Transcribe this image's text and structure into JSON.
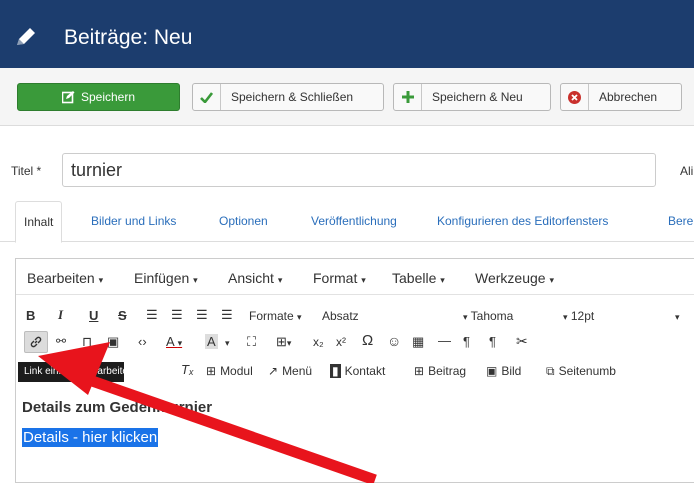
{
  "header": {
    "title": "Beiträge: Neu"
  },
  "toolbar": {
    "save": "Speichern",
    "save_close": "Speichern & Schließen",
    "save_new": "Speichern & Neu",
    "cancel": "Abbrechen"
  },
  "form": {
    "title_label": "Titel *",
    "title_value": "turnier",
    "alias_label": "Ali"
  },
  "tabs": [
    {
      "label": "Inhalt",
      "active": true
    },
    {
      "label": "Bilder und Links"
    },
    {
      "label": "Optionen"
    },
    {
      "label": "Veröffentlichung"
    },
    {
      "label": "Konfigurieren des Editorfensters"
    },
    {
      "label": "Bere"
    }
  ],
  "editor": {
    "menus": [
      "Bearbeiten",
      "Einfügen",
      "Ansicht",
      "Format",
      "Tabelle",
      "Werkzeuge"
    ],
    "formats_label": "Formate",
    "block_label": "Absatz",
    "font_label": "Tahoma",
    "size_label": "12pt",
    "insert_buttons": [
      "Modul",
      "Menü",
      "Kontakt",
      "Beitrag",
      "Bild",
      "Seitenumb"
    ],
    "tooltip": "Link einfügen/bearbeiten",
    "heading": "Details zum Gedenkturnier",
    "link_text": "Details - hier klicken"
  },
  "colors": {
    "header_bg": "#1c3d6e",
    "save_green": "#3a9a3a",
    "tab_link": "#2a6ebb",
    "selection": "#1a73e8",
    "arrow": "#e8141c"
  }
}
